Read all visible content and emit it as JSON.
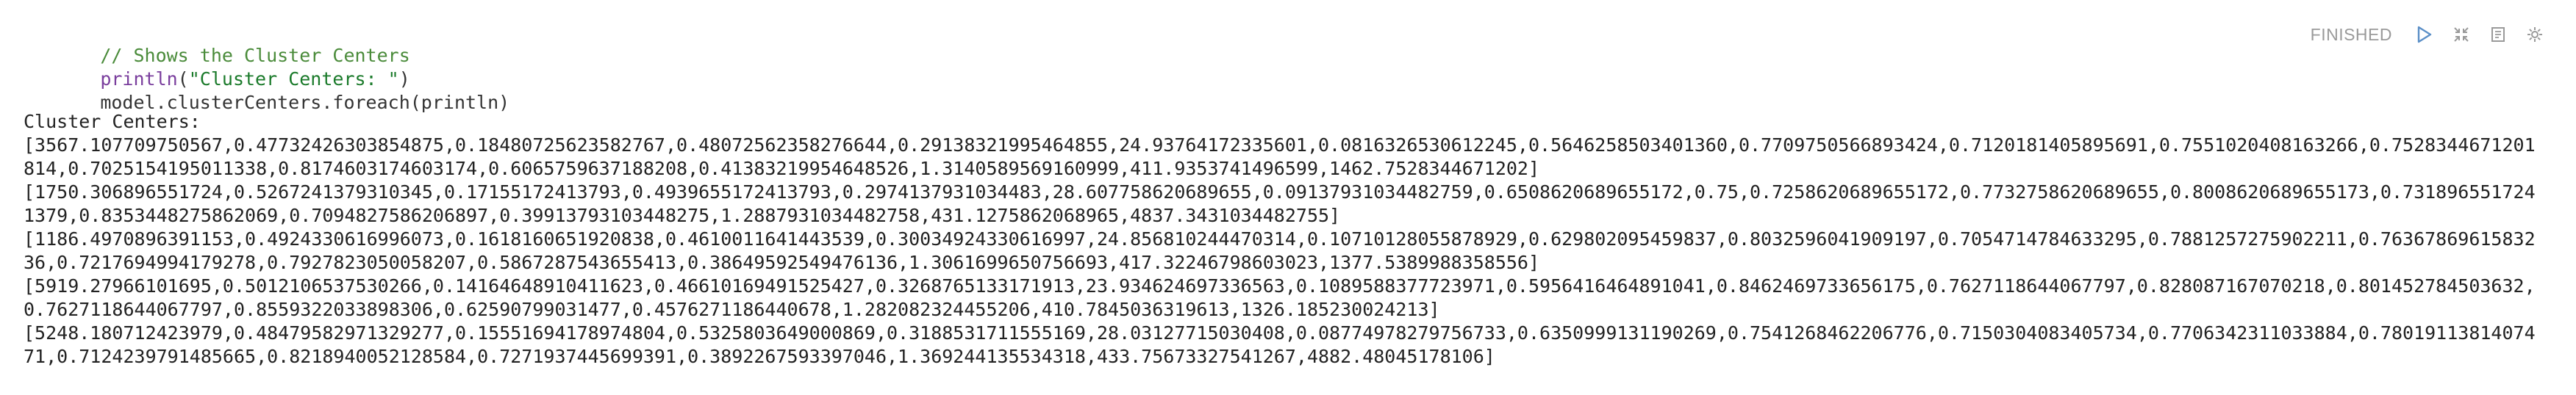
{
  "code": {
    "line1": "// Shows the Cluster Centers",
    "line2_fn": "println",
    "line2_open": "(",
    "line2_str": "\"Cluster Centers: \"",
    "line2_close": ")",
    "line3": "model.clusterCenters.foreach(println)"
  },
  "controls": {
    "status": "FINISHED",
    "icons": [
      "play-icon",
      "collapse-icon",
      "book-icon",
      "gear-icon"
    ]
  },
  "output": {
    "header": "Cluster Centers:",
    "centers": [
      "[3567.107709750567,0.47732426303854875,0.18480725623582767,0.48072562358276644,0.29138321995464855,24.93764172335601,0.0816326530612245,0.5646258503401360,0.7709750566893424,0.7120181405895691,0.7551020408163266,0.7528344671201814,0.7025154195011338,0.8174603174603174,0.6065759637188208,0.41383219954648526,1.3140589569160999,411.9353741496599,1462.7528344671202]",
      "[1750.306896551724,0.5267241379310345,0.17155172413793,0.4939655172413793,0.2974137931034483,28.607758620689655,0.09137931034482759,0.6508620689655172,0.75,0.7258620689655172,0.7732758620689655,0.8008620689655173,0.7318965517241379,0.8353448275862069,0.7094827586206897,0.39913793103448275,1.2887931034482758,431.1275862068965,4837.3431034482755]",
      "[1186.4970896391153,0.4924330616996073,0.1618160651920838,0.4610011641443539,0.30034924330616997,24.856810244470314,0.10710128055878929,0.629802095459837,0.8032596041909197,0.7054714784633295,0.7881257275902211,0.7636786961583236,0.7217694994179278,0.7927823050058207,0.5867287543655413,0.38649592549476136,1.3061699650756693,417.32246798603023,1377.5389988358556]",
      "[5919.27966101695,0.5012106537530266,0.14164648910411623,0.46610169491525427,0.3268765133171913,23.934624697336563,0.1089588377723971,0.5956416464891041,0.8462469733656175,0.7627118644067797,0.828087167070218,0.801452784503632,0.7627118644067797,0.8559322033898306,0.62590799031477,0.4576271186440678,1.282082324455206,410.7845036319613,1326.185230024213]",
      "[5248.180712423979,0.48479582971329277,0.15551694178974804,0.5325803649000869,0.3188531711555169,28.03127715030408,0.08774978279756733,0.6350999131190269,0.7541268462206776,0.7150304083405734,0.7706342311033884,0.7801911381407471,0.7124239791485665,0.8218940052128584,0.7271937445699391,0.3892267593397046,1.369244135534318,433.75673327541267,4882.48045178106]"
    ]
  }
}
